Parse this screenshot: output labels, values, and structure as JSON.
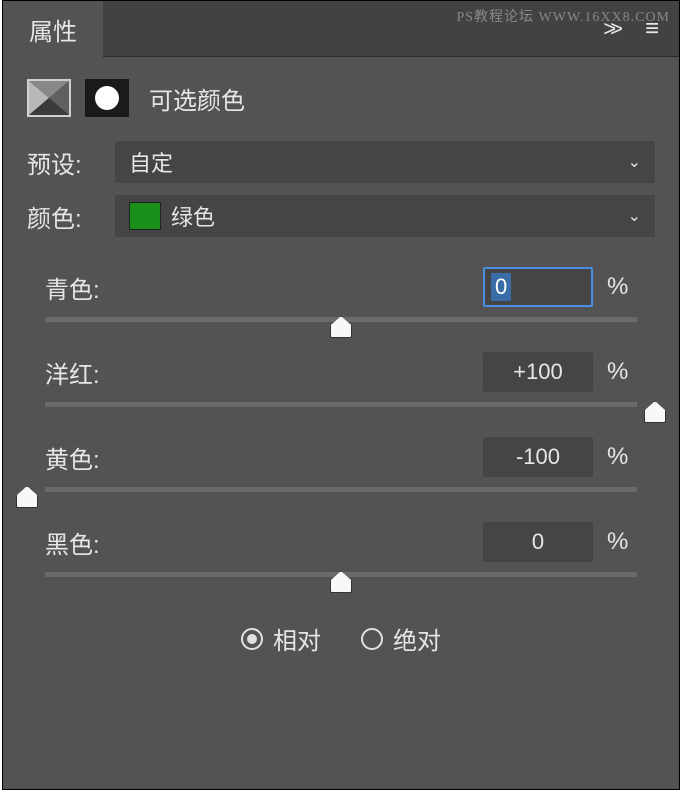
{
  "watermark": "PS教程论坛 WWW.16XX8.COM",
  "tab": {
    "title": "属性"
  },
  "adjustment": {
    "title": "可选颜色"
  },
  "preset": {
    "label": "预设:",
    "value": "自定"
  },
  "color": {
    "label": "颜色:",
    "value": "绿色",
    "swatch_hex": "#1a8f1a"
  },
  "sliders": [
    {
      "label": "青色:",
      "value": "0",
      "pos": 50,
      "focused": true
    },
    {
      "label": "洋红:",
      "value": "+100",
      "pos": 100,
      "focused": false
    },
    {
      "label": "黄色:",
      "value": "-100",
      "pos": 0,
      "focused": false
    },
    {
      "label": "黑色:",
      "value": "0",
      "pos": 50,
      "focused": false
    }
  ],
  "method": {
    "options": [
      {
        "label": "相对",
        "checked": true
      },
      {
        "label": "绝对",
        "checked": false
      }
    ]
  },
  "percent_sign": "%"
}
